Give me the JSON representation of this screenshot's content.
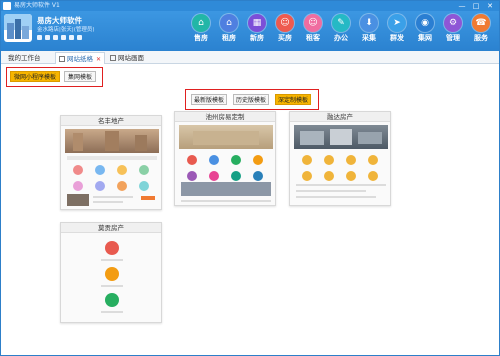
{
  "window": {
    "title": "易房大师软件 V1",
    "controls": [
      "—",
      "□",
      "✕"
    ]
  },
  "brand": {
    "name": "易房大师软件",
    "subtitle": "金水路店|张天|(管理员)"
  },
  "nav": [
    {
      "label": "售房",
      "icon": "home-sale-icon",
      "glyph": "⌂",
      "color": "#22b6a7"
    },
    {
      "label": "租房",
      "icon": "home-rent-icon",
      "glyph": "⌂",
      "color": "#4f7fe0"
    },
    {
      "label": "新房",
      "icon": "building-icon",
      "glyph": "▦",
      "color": "#7c4fd8"
    },
    {
      "label": "买房",
      "icon": "buyer-icon",
      "glyph": "☺",
      "color": "#ee5a4f"
    },
    {
      "label": "租客",
      "icon": "tenant-icon",
      "glyph": "☺",
      "color": "#f06da0"
    },
    {
      "label": "办公",
      "icon": "office-icon",
      "glyph": "✎",
      "color": "#25b9c5"
    },
    {
      "label": "采集",
      "icon": "collect-icon",
      "glyph": "⬇",
      "color": "#4a90e2"
    },
    {
      "label": "群发",
      "icon": "broadcast-icon",
      "glyph": "➤",
      "color": "#3aa0e8"
    },
    {
      "label": "集网",
      "icon": "network-icon",
      "glyph": "◉",
      "color": "#2a7ed2"
    },
    {
      "label": "管理",
      "icon": "settings-icon",
      "glyph": "⚙",
      "color": "#8e56d6"
    },
    {
      "label": "服务",
      "icon": "service-icon",
      "glyph": "☎",
      "color": "#f07a32"
    }
  ],
  "tabs": [
    {
      "label": "我的工作台",
      "active": false
    },
    {
      "label": "网站纸格",
      "active": true
    },
    {
      "label": "网站画面",
      "active": false
    }
  ],
  "subtabs": {
    "items": [
      "微网小程序模板",
      "集网模板"
    ],
    "active_index": 0
  },
  "modes": {
    "items": [
      "最新版模板",
      "历史版模板",
      "深定制模板"
    ],
    "active_index": 2
  },
  "templates": [
    {
      "title": "名丰地产"
    },
    {
      "title": "池州房易定制"
    },
    {
      "title": "融达房产"
    },
    {
      "title": "莫贡房产"
    }
  ]
}
